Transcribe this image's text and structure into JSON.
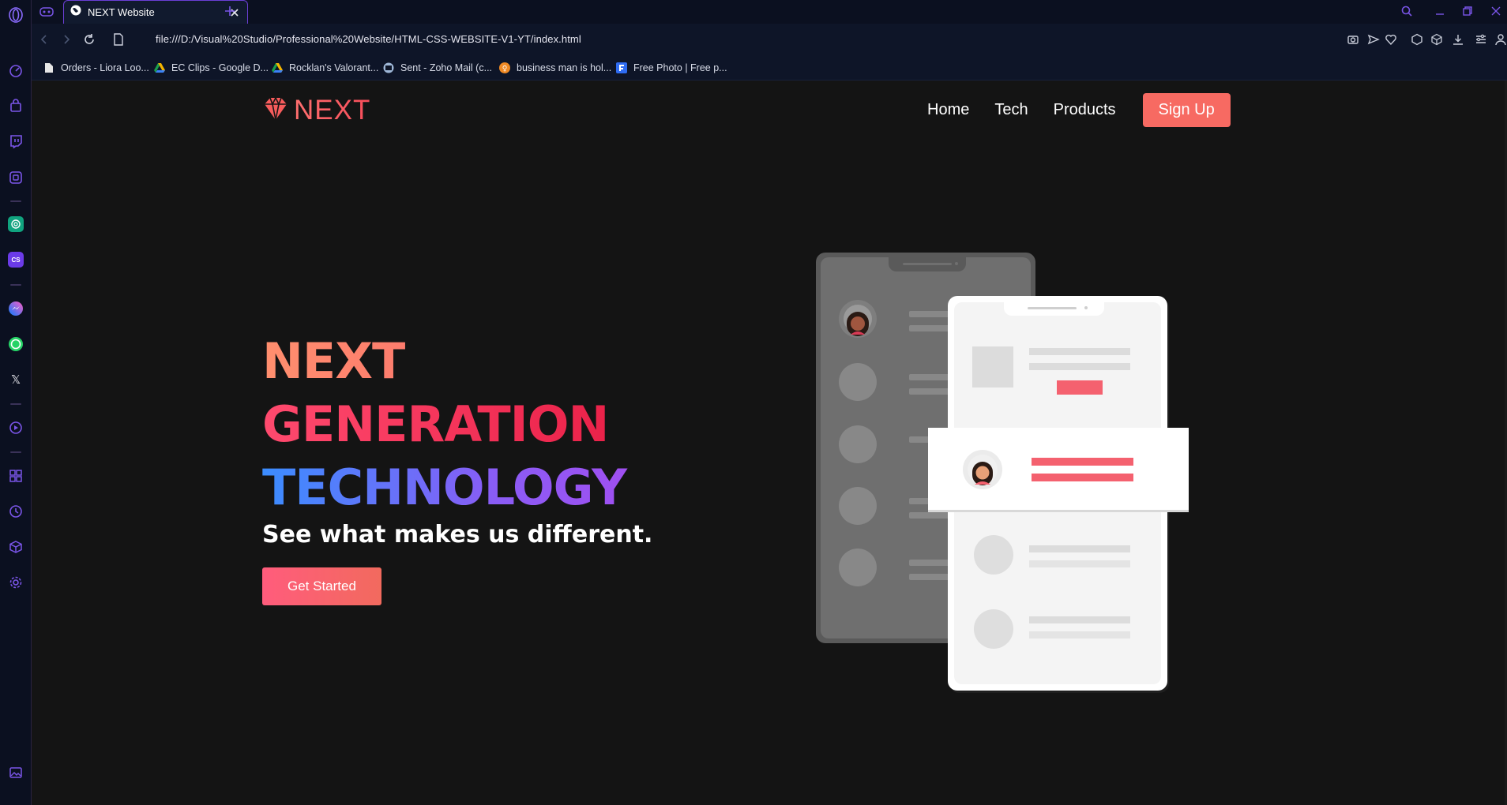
{
  "browser": {
    "tab": {
      "title": "NEXT Website"
    },
    "address": {
      "url": "file:///D:/Visual%20Studio/Professional%20Website/HTML-CSS-WEBSITE-V1-YT/index.html"
    },
    "bookmarks": [
      {
        "label": "Orders - Liora Loo...",
        "icon": "document-icon",
        "color": "#e6e6e6"
      },
      {
        "label": "EC Clips - Google D...",
        "icon": "google-drive-icon",
        "color": "#f3b400"
      },
      {
        "label": "Rocklan's Valorant...",
        "icon": "google-drive-icon",
        "color": "#f3b400"
      },
      {
        "label": "Sent - Zoho Mail (c...",
        "icon": "zoho-mail-icon",
        "color": "#9fb8d8"
      },
      {
        "label": "business man is hol...",
        "icon": "photo-site-icon",
        "color": "#f08a24"
      },
      {
        "label": "Free Photo | Free p...",
        "icon": "freepik-icon",
        "color": "#2f6cf2"
      }
    ],
    "accent": "#7a45e6"
  },
  "site": {
    "logo": {
      "text": "NEXT",
      "icon": "gem-icon",
      "color": "#f75c5c"
    },
    "nav": {
      "home": "Home",
      "tech": "Tech",
      "products": "Products",
      "signup": "Sign Up"
    },
    "hero": {
      "line1": "NEXT",
      "line2": "GENERATION",
      "line3": "TECHNOLOGY",
      "tagline": "See what makes us different.",
      "cta": "Get Started"
    },
    "illustration": {
      "icon": "phones-illustration",
      "accent": "#f4616f"
    }
  }
}
